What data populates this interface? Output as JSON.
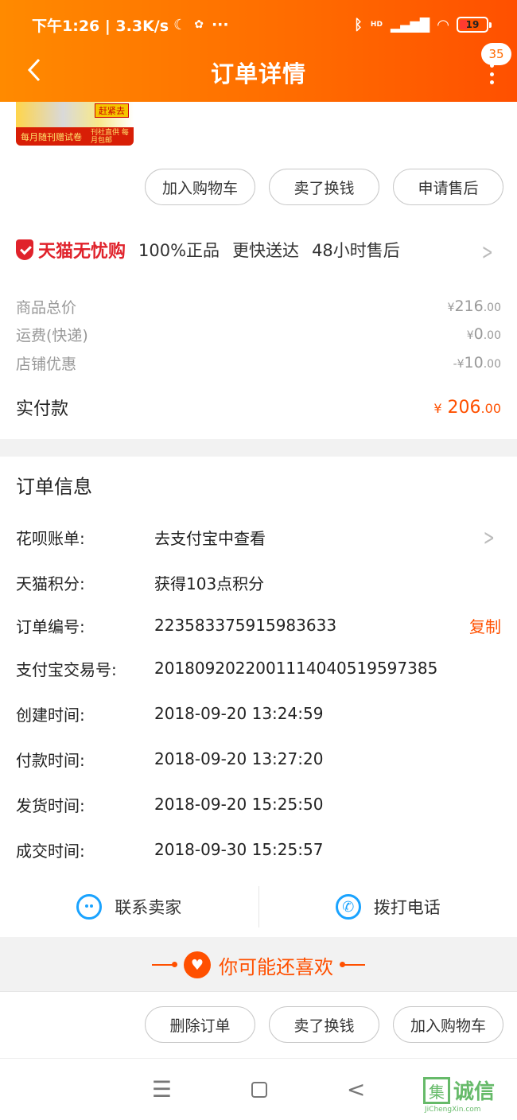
{
  "status_bar": {
    "left_text": "下午1:26 | 3.3K/s",
    "battery_level": "19",
    "signal_label": "HD"
  },
  "header": {
    "title": "订单详情",
    "badge_count": "35"
  },
  "product_thumb": {
    "corner_tag": "赶紧去",
    "strip_left": "每月随刊赠试卷",
    "strip_right": "刊社直供 每月包邮"
  },
  "actions_top": [
    "加入购物车",
    "卖了换钱",
    "申请售后"
  ],
  "tmall": {
    "brand": "天猫无忧购",
    "features": [
      "100%正品",
      "更快送达",
      "48小时售后"
    ]
  },
  "price_rows": [
    {
      "label": "商品总价",
      "currency": "¥",
      "int": "216",
      "dec": ".00",
      "prefix": ""
    },
    {
      "label": "运费(快递)",
      "currency": "¥",
      "int": "0",
      "dec": ".00",
      "prefix": ""
    },
    {
      "label": "店铺优惠",
      "currency": "¥",
      "int": "10",
      "dec": ".00",
      "prefix": "-"
    }
  ],
  "actual_pay": {
    "label": "实付款",
    "currency": "¥",
    "int": "206",
    "dec": ".00"
  },
  "order_info": {
    "title": "订单信息",
    "rows": [
      {
        "key": "花呗账单:",
        "value": "去支付宝中查看"
      },
      {
        "key": "天猫积分:",
        "value": "获得103点积分"
      },
      {
        "key": "订单编号:",
        "value": "223583375915983633",
        "action": "复制"
      },
      {
        "key": "支付宝交易号:",
        "value": "2018092022001114040519597385"
      },
      {
        "key": "创建时间:",
        "value": "2018-09-20 13:24:59"
      },
      {
        "key": "付款时间:",
        "value": "2018-09-20 13:27:20"
      },
      {
        "key": "发货时间:",
        "value": "2018-09-20 15:25:50"
      },
      {
        "key": "成交时间:",
        "value": "2018-09-30 15:25:57"
      }
    ]
  },
  "contact": {
    "seller": "联系卖家",
    "call": "拨打电话"
  },
  "recommend": {
    "title": "你可能还喜欢"
  },
  "actions_bottom": [
    "删除订单",
    "卖了换钱",
    "加入购物车"
  ],
  "watermark": {
    "text": "诚信",
    "url": "JiChengXin.com",
    "box": "集"
  },
  "colors": {
    "accent": "#ff5000",
    "header_start": "#ff8a00",
    "tmall_red": "#e0222b",
    "link_blue": "#1aa3ff"
  }
}
